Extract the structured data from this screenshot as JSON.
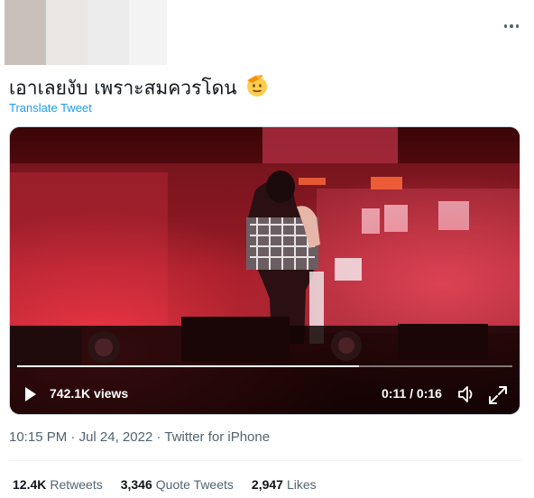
{
  "tweet": {
    "text": "เอาเลยงับ เพราะสมควรโดน",
    "emoji": "saluting-face",
    "translate_label": "Translate Tweet"
  },
  "video": {
    "views": "742.1K views",
    "time": "0:11 / 0:16",
    "progress": 0.69
  },
  "meta": {
    "time": "10:15 PM",
    "separator1": " · ",
    "date": "Jul 24, 2022",
    "separator2": " · ",
    "source": "Twitter for iPhone"
  },
  "stats": {
    "retweets_count": "12.4K",
    "retweets_label": "Retweets",
    "quotes_count": "3,346",
    "quotes_label": "Quote Tweets",
    "likes_count": "2,947",
    "likes_label": "Likes"
  },
  "colors": {
    "link": "#1d9bf0",
    "secondary_text": "#536471",
    "stage_red": "#b8182a"
  }
}
